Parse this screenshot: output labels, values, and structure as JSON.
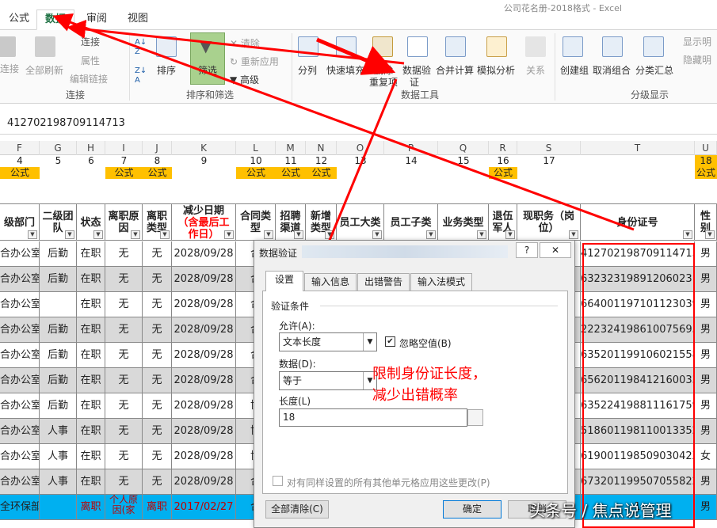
{
  "titlebar": {
    "text": "公司花名册-2018格式 - Excel"
  },
  "tabs": [
    "公式",
    "数据",
    "审阅",
    "视图"
  ],
  "ribbon": {
    "connections": {
      "refresh_all": "全部刷新",
      "connect": "连接",
      "properties": "属性",
      "edit_links": "编辑链接",
      "group": "连接",
      "refresh_partial": "连接"
    },
    "sort_filter": {
      "sort": "排序",
      "filter": "筛选",
      "clear": "清除",
      "reapply": "重新应用",
      "advanced": "高级",
      "group": "排序和筛选"
    },
    "data_tools": {
      "text_to_columns": "分列",
      "flash_fill": "快速填充",
      "remove_dups_top": "删除",
      "remove_dups_bottom": "重复项",
      "data_validation_top": "数据验",
      "data_validation_bottom": "证",
      "consolidate": "合并计算",
      "what_if": "模拟分析",
      "relationships": "关系",
      "group": "数据工具"
    },
    "outline": {
      "group_btn": "创建组",
      "ungroup": "取消组合",
      "subtotal": "分类汇总",
      "show_detail": "显示明",
      "hide_detail": "隐藏明",
      "group": "分级显示"
    }
  },
  "formula_bar": {
    "value": "412702198709114713"
  },
  "columns": [
    "F",
    "G",
    "H",
    "I",
    "J",
    "K",
    "L",
    "M",
    "N",
    "O",
    "P",
    "Q",
    "R",
    "S",
    "T",
    "U"
  ],
  "row4": [
    "4",
    "5",
    "6",
    "7",
    "8",
    "9",
    "10",
    "11",
    "12",
    "13",
    "14",
    "15",
    "16",
    "17",
    "18"
  ],
  "row5_tag": "公式",
  "headers": [
    "级部门",
    "二级团队",
    "状态",
    "离职原因",
    "离职类型",
    "减少日期",
    "（含最后工作日）",
    "合同类型",
    "招聘渠道",
    "新增类型",
    "员工大类",
    "员工子类",
    "业务类型",
    "退伍军人",
    "现职务（岗位）",
    "身份证号",
    "性别"
  ],
  "rows": [
    {
      "dept": "合办公室",
      "team": "后勤",
      "status": "在职",
      "reason": "无",
      "type": "无",
      "date": "2028/09/28",
      "contract": "合",
      "id": "412702198709114713",
      "sex": "男"
    },
    {
      "dept": "合办公室",
      "team": "后勤",
      "status": "在职",
      "reason": "无",
      "type": "无",
      "date": "2028/09/28",
      "contract": "合",
      "id": "632323198912060231",
      "sex": "男"
    },
    {
      "dept": "合办公室",
      "team": "",
      "status": "在职",
      "reason": "无",
      "type": "无",
      "date": "2028/09/28",
      "contract": "合",
      "id": "664001197101123039",
      "sex": "男"
    },
    {
      "dept": "合办公室",
      "team": "后勤",
      "status": "在职",
      "reason": "无",
      "type": "无",
      "date": "2028/09/28",
      "contract": "合",
      "id": "222324198610075695",
      "sex": "男"
    },
    {
      "dept": "合办公室",
      "team": "后勤",
      "status": "在职",
      "reason": "无",
      "type": "无",
      "date": "2028/09/28",
      "contract": "合",
      "id": "635201199106021558",
      "sex": "男"
    },
    {
      "dept": "合办公室",
      "team": "后勤",
      "status": "在职",
      "reason": "无",
      "type": "无",
      "date": "2028/09/28",
      "contract": "合",
      "id": "656201198412160033",
      "sex": "男"
    },
    {
      "dept": "合办公室",
      "team": "后勤",
      "status": "在职",
      "reason": "无",
      "type": "无",
      "date": "2028/09/28",
      "contract": "协",
      "id": "635224198811161759",
      "sex": "男"
    },
    {
      "dept": "合办公室",
      "team": "人事",
      "status": "在职",
      "reason": "无",
      "type": "无",
      "date": "2028/09/28",
      "contract": "协",
      "id": "518601198110013352",
      "sex": "男"
    },
    {
      "dept": "合办公室",
      "team": "人事",
      "status": "在职",
      "reason": "无",
      "type": "无",
      "date": "2028/09/28",
      "contract": "协",
      "id": "61900119850903042X",
      "sex": "女"
    },
    {
      "dept": "合办公室",
      "team": "人事",
      "status": "在职",
      "reason": "无",
      "type": "无",
      "date": "2028/09/28",
      "contract": "合",
      "id": "673201199507055822",
      "sex": "男"
    },
    {
      "dept": "全环保部",
      "team": "",
      "status": "离职",
      "reason": "个人原因(家",
      "type": "离职",
      "date": "2017/02/27",
      "contract": "合",
      "id": "1",
      "sex": "男"
    }
  ],
  "dialog": {
    "title": "数据验证",
    "help": "?",
    "close": "✕",
    "tabs": [
      "设置",
      "输入信息",
      "出错警告",
      "输入法模式"
    ],
    "section": "验证条件",
    "allow_label": "允许(A):",
    "allow_value": "文本长度",
    "ignore_blank": "忽略空值(B)",
    "data_label": "数据(D):",
    "data_value": "等于",
    "length_label": "长度(L)",
    "length_value": "18",
    "apply_all": "对有同样设置的所有其他单元格应用这些更改(P)",
    "clear_all": "全部清除(C)",
    "ok": "确定",
    "cancel": "取消"
  },
  "annotation": {
    "line1": "限制身份证长度，",
    "line2": "减少出错概率"
  },
  "watermark": "头条号 / 焦点说管理",
  "colors": {
    "accent": "#217346",
    "highlight": "#ffc000",
    "arrow": "#ff0000",
    "blue_row": "#00b0f0"
  }
}
